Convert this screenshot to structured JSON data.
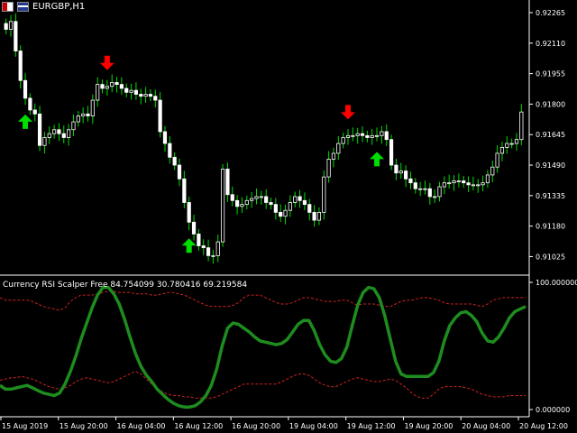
{
  "window": {
    "symbol_title": "EURGBP,H1",
    "flag_icons": [
      "eu-flag-icon",
      "uk-flag-icon"
    ]
  },
  "indicator": {
    "label": "Currency RSI Scalper Free 84.754099 30.780416 69.219584",
    "scale_top": "100.000000",
    "scale_bottom": "0.000000"
  },
  "price_axis": {
    "ticks": [
      "0.92265",
      "0.92110",
      "0.91955",
      "0.91800",
      "0.91645",
      "0.91490",
      "0.91335",
      "0.91180",
      "0.91025"
    ]
  },
  "time_axis": {
    "ticks": [
      "15 Aug 2019",
      "15 Aug 20:00",
      "16 Aug 04:00",
      "16 Aug 12:00",
      "16 Aug 20:00",
      "19 Aug 04:00",
      "19 Aug 12:00",
      "19 Aug 20:00",
      "20 Aug 04:00",
      "20 Aug 12:00"
    ]
  },
  "colors": {
    "background": "#000000",
    "candle": "#ffffff",
    "wick": "#00dd00",
    "buy_arrow": "#00dd00",
    "sell_arrow": "#ff0000",
    "rsi_line": "#1e8c1e",
    "bands": "#cc2222",
    "separator": "#ffffff"
  },
  "chart_data": [
    {
      "type": "candlestick",
      "title": "EURGBP,H1",
      "ylim": [
        0.9094,
        0.9232
      ],
      "closes": [
        0.9218,
        0.9222,
        0.9207,
        0.9192,
        0.9183,
        0.9177,
        0.9175,
        0.9159,
        0.9163,
        0.9165,
        0.9167,
        0.9165,
        0.9163,
        0.9167,
        0.9171,
        0.9174,
        0.9175,
        0.9174,
        0.9182,
        0.919,
        0.9188,
        0.9189,
        0.9191,
        0.919,
        0.9188,
        0.9186,
        0.9187,
        0.9185,
        0.9184,
        0.9185,
        0.9184,
        0.9182,
        0.9166,
        0.916,
        0.9153,
        0.9149,
        0.9142,
        0.913,
        0.912,
        0.9114,
        0.9108,
        0.9107,
        0.9103,
        0.9103,
        0.911,
        0.9147,
        0.9134,
        0.9131,
        0.9128,
        0.9129,
        0.9131,
        0.9132,
        0.9133,
        0.9133,
        0.913,
        0.9129,
        0.9125,
        0.9123,
        0.9126,
        0.913,
        0.9133,
        0.9131,
        0.9129,
        0.9125,
        0.9121,
        0.9125,
        0.9143,
        0.9152,
        0.9155,
        0.916,
        0.9163,
        0.9164,
        0.9164,
        0.9165,
        0.9164,
        0.9163,
        0.9164,
        0.9164,
        0.9166,
        0.9162,
        0.9149,
        0.9145,
        0.9146,
        0.9142,
        0.914,
        0.9137,
        0.9137,
        0.9137,
        0.9133,
        0.9133,
        0.9138,
        0.914,
        0.914,
        0.9141,
        0.9141,
        0.914,
        0.9139,
        0.9139,
        0.9139,
        0.914,
        0.9144,
        0.9148,
        0.9155,
        0.9158,
        0.916,
        0.916,
        0.9162,
        0.9176
      ],
      "sell_signals_at_bar": [
        21,
        71
      ],
      "buy_signals_at_bar": [
        4,
        38,
        77
      ],
      "price_ticks": [
        0.92265,
        0.9211,
        0.91955,
        0.918,
        0.91645,
        0.9149,
        0.91335,
        0.9118,
        0.91025
      ]
    },
    {
      "type": "line",
      "title": "Currency RSI Scalper Free",
      "ylim": [
        0,
        100
      ],
      "series": [
        {
          "values": [
            19,
            16,
            16,
            17,
            18,
            19,
            17,
            15,
            13,
            12,
            11,
            13,
            20,
            30,
            42,
            56,
            68,
            80,
            90,
            96,
            96,
            91,
            83,
            71,
            57,
            44,
            34,
            27,
            22,
            16,
            12,
            8,
            5,
            3,
            2,
            2,
            3,
            6,
            11,
            19,
            32,
            50,
            64,
            68,
            67,
            64,
            61,
            57,
            54,
            53,
            52,
            51,
            52,
            55,
            61,
            67,
            70,
            70,
            62,
            51,
            43,
            38,
            37,
            40,
            49,
            66,
            82,
            92,
            96,
            95,
            88,
            74,
            56,
            38,
            28,
            26,
            26,
            26,
            26,
            26,
            29,
            38,
            54,
            66,
            72,
            76,
            77,
            74,
            69,
            60,
            54,
            53,
            57,
            64,
            72,
            77,
            79,
            81
          ]
        },
        {
          "values": [
            88,
            86,
            86,
            86,
            86,
            86,
            85,
            83,
            81,
            80,
            79,
            78,
            80,
            85,
            88,
            90,
            90,
            90,
            91,
            92,
            93,
            93,
            92,
            92,
            92,
            91,
            91,
            91,
            90,
            90,
            91,
            92,
            92,
            91,
            90,
            88,
            86,
            84,
            82,
            81,
            81,
            81,
            81,
            82,
            84,
            88,
            90,
            90,
            90,
            88,
            86,
            84,
            83,
            83,
            84,
            86,
            88,
            88,
            87,
            86,
            85,
            85,
            85,
            86,
            86,
            84,
            82,
            83,
            83,
            83,
            82,
            81,
            81,
            83,
            85,
            86,
            86,
            87,
            88,
            88,
            87,
            86,
            84,
            83,
            83,
            83,
            83,
            83,
            82,
            81,
            83,
            86,
            87,
            88,
            88,
            88,
            88,
            88
          ]
        },
        {
          "values": [
            23,
            24,
            25,
            25,
            26,
            25,
            24,
            22,
            20,
            18,
            17,
            16,
            17,
            19,
            22,
            24,
            25,
            24,
            23,
            22,
            21,
            22,
            24,
            26,
            28,
            30,
            28,
            24,
            20,
            16,
            14,
            12,
            11,
            11,
            10,
            10,
            9,
            9,
            9,
            9,
            10,
            12,
            14,
            16,
            18,
            20,
            20,
            20,
            20,
            20,
            20,
            20,
            22,
            24,
            26,
            28,
            28,
            27,
            24,
            21,
            19,
            18,
            18,
            20,
            22,
            24,
            25,
            24,
            23,
            22,
            22,
            23,
            24,
            23,
            20,
            17,
            13,
            10,
            9,
            9,
            12,
            16,
            18,
            18,
            18,
            18,
            17,
            16,
            14,
            12,
            11,
            10,
            10,
            10,
            11,
            11,
            11,
            11
          ]
        }
      ],
      "time_ticks": [
        "15 Aug 2019",
        "15 Aug 20:00",
        "16 Aug 04:00",
        "16 Aug 12:00",
        "16 Aug 20:00",
        "19 Aug 04:00",
        "19 Aug 12:00",
        "19 Aug 20:00",
        "20 Aug 04:00",
        "20 Aug 12:00"
      ]
    }
  ]
}
